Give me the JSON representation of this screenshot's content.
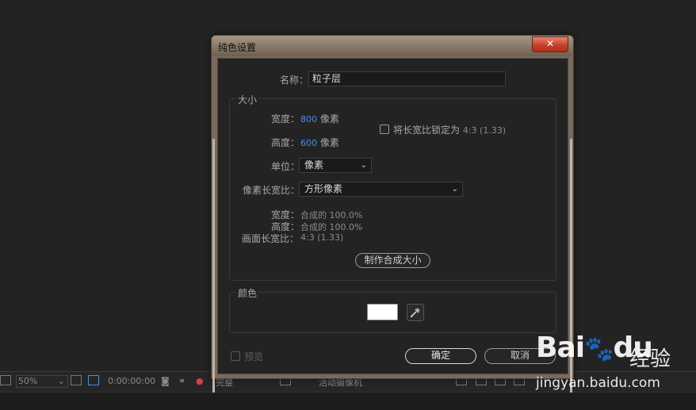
{
  "dialog": {
    "title": "纯色设置",
    "close_glyph": "✕",
    "name_label": "名称：",
    "name_value": "粒子层",
    "size": {
      "group_label": "大小",
      "width_label": "宽度：",
      "width_value": "800",
      "width_unit": "像素",
      "height_label": "高度：",
      "height_value": "600",
      "height_unit": "像素",
      "lock_label": "将长宽比锁定为",
      "lock_ratio": "4:3 (1.33)",
      "unit_label": "单位：",
      "unit_value": "像素",
      "pixel_aspect_label": "像素长宽比：",
      "pixel_aspect_value": "方形像素",
      "info_width_label": "宽度：",
      "info_width_value": "合成的 100.0%",
      "info_height_label": "高度：",
      "info_height_value": "合成的 100.0%",
      "info_frame_label": "画面长宽比：",
      "info_frame_value": "4:3 (1.33)",
      "make_comp_size": "制作合成大小"
    },
    "color": {
      "group_label": "颜色",
      "swatch_color": "#ffffff"
    },
    "preview_label": "预览",
    "ok_label": "确定",
    "cancel_label": "取消"
  },
  "bottom_bar": {
    "zoom": "50%",
    "timecode": "0:00:00:00",
    "label_a": "完整",
    "label_b": "活动摄像机"
  },
  "watermark": {
    "logo": "Bai",
    "logo_suffix": "du",
    "sub": "经验",
    "url": "jingyan.baidu.com"
  }
}
